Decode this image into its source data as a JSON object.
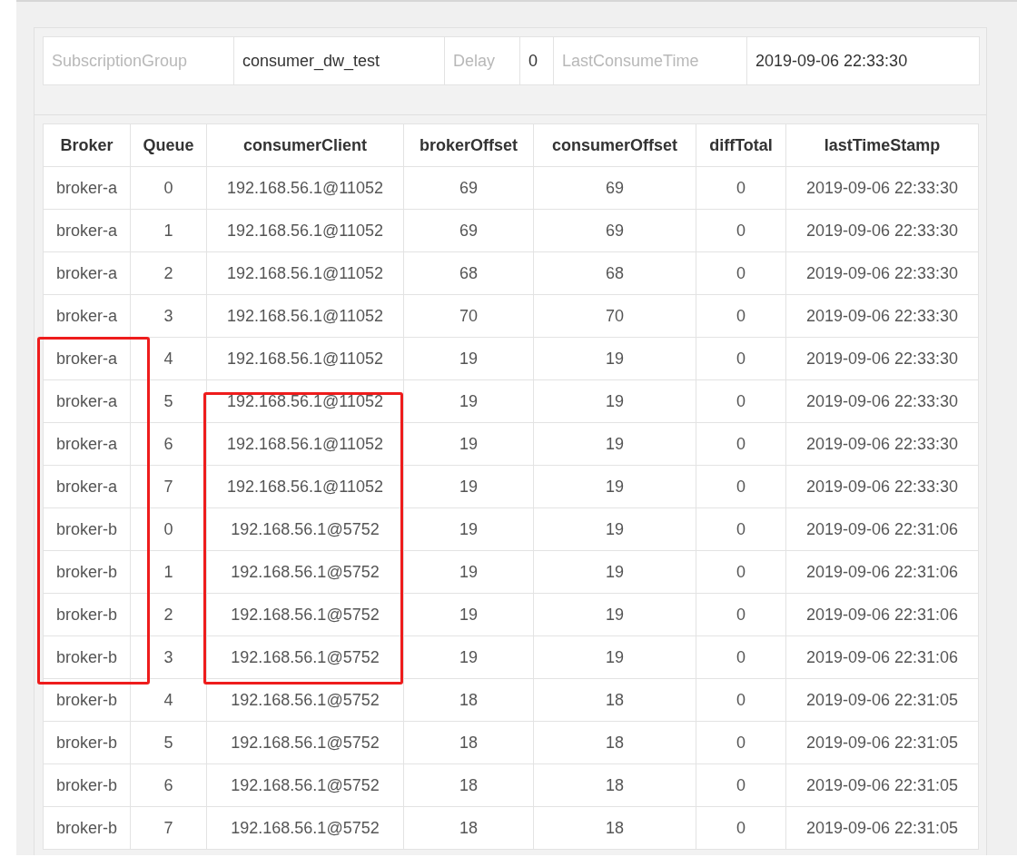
{
  "summary": [
    {
      "kind": "label",
      "text": "SubscriptionGroup"
    },
    {
      "kind": "value",
      "text": "consumer_dw_test"
    },
    {
      "kind": "label",
      "text": "Delay"
    },
    {
      "kind": "value",
      "text": "0"
    },
    {
      "kind": "label",
      "text": "LastConsumeTime"
    },
    {
      "kind": "value",
      "text": "2019-09-06 22:33:30"
    }
  ],
  "table": {
    "columns": [
      "Broker",
      "Queue",
      "consumerClient",
      "brokerOffset",
      "consumerOffset",
      "diffTotal",
      "lastTimeStamp"
    ],
    "rows": [
      [
        "broker-a",
        "0",
        "192.168.56.1@11052",
        "69",
        "69",
        "0",
        "2019-09-06 22:33:30"
      ],
      [
        "broker-a",
        "1",
        "192.168.56.1@11052",
        "69",
        "69",
        "0",
        "2019-09-06 22:33:30"
      ],
      [
        "broker-a",
        "2",
        "192.168.56.1@11052",
        "68",
        "68",
        "0",
        "2019-09-06 22:33:30"
      ],
      [
        "broker-a",
        "3",
        "192.168.56.1@11052",
        "70",
        "70",
        "0",
        "2019-09-06 22:33:30"
      ],
      [
        "broker-a",
        "4",
        "192.168.56.1@11052",
        "19",
        "19",
        "0",
        "2019-09-06 22:33:30"
      ],
      [
        "broker-a",
        "5",
        "192.168.56.1@11052",
        "19",
        "19",
        "0",
        "2019-09-06 22:33:30"
      ],
      [
        "broker-a",
        "6",
        "192.168.56.1@11052",
        "19",
        "19",
        "0",
        "2019-09-06 22:33:30"
      ],
      [
        "broker-a",
        "7",
        "192.168.56.1@11052",
        "19",
        "19",
        "0",
        "2019-09-06 22:33:30"
      ],
      [
        "broker-b",
        "0",
        "192.168.56.1@5752",
        "19",
        "19",
        "0",
        "2019-09-06 22:31:06"
      ],
      [
        "broker-b",
        "1",
        "192.168.56.1@5752",
        "19",
        "19",
        "0",
        "2019-09-06 22:31:06"
      ],
      [
        "broker-b",
        "2",
        "192.168.56.1@5752",
        "19",
        "19",
        "0",
        "2019-09-06 22:31:06"
      ],
      [
        "broker-b",
        "3",
        "192.168.56.1@5752",
        "19",
        "19",
        "0",
        "2019-09-06 22:31:06"
      ],
      [
        "broker-b",
        "4",
        "192.168.56.1@5752",
        "18",
        "18",
        "0",
        "2019-09-06 22:31:05"
      ],
      [
        "broker-b",
        "5",
        "192.168.56.1@5752",
        "18",
        "18",
        "0",
        "2019-09-06 22:31:05"
      ],
      [
        "broker-b",
        "6",
        "192.168.56.1@5752",
        "18",
        "18",
        "0",
        "2019-09-06 22:31:05"
      ],
      [
        "broker-b",
        "7",
        "192.168.56.1@5752",
        "18",
        "18",
        "0",
        "2019-09-06 22:31:05"
      ]
    ]
  }
}
